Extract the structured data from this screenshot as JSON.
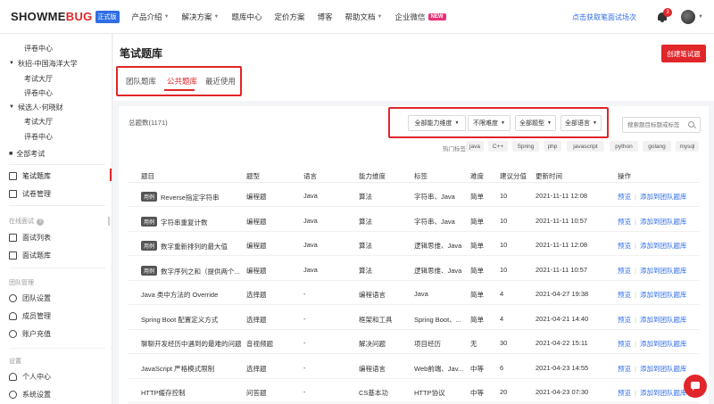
{
  "brand": {
    "logo_main": "SHOWME",
    "logo_accent": "BUG",
    "edition": "正式版"
  },
  "nav": {
    "items": [
      {
        "label": "产品介绍",
        "caret": true
      },
      {
        "label": "解决方案",
        "caret": true
      },
      {
        "label": "题库中心",
        "caret": false
      },
      {
        "label": "定价方案",
        "caret": false
      },
      {
        "label": "博客",
        "caret": false
      },
      {
        "label": "帮助文档",
        "caret": true
      },
      {
        "label": "企业微信",
        "caret": false
      }
    ],
    "new_badge": "NEW",
    "apply_link": "点击获取笔面试场次",
    "notification_count": "3"
  },
  "sidebar": {
    "items": [
      "评卷中心",
      "秋招-中国海洋大学",
      "考试大厅",
      "评卷中心",
      "候选人-何晓财",
      "考试大厅",
      "评卷中心",
      "全部考试",
      "笔试题库",
      "试卷管理",
      "面试列表",
      "面试题库",
      "团队设置",
      "成员管理",
      "账户充值",
      "个人中心",
      "系统设置"
    ],
    "sections": [
      "在线面试",
      "团队管理",
      "设置"
    ],
    "active": "笔试题库"
  },
  "header": {
    "title": "笔试题库",
    "create_button": "创建笔试题",
    "tabs": [
      "团队题库",
      "公共题库",
      "最近使用"
    ],
    "active_tab": "公共题库"
  },
  "filters": {
    "total": "总题数(1171)",
    "ability": "全部能力维度",
    "difficulty": "不限难度",
    "type": "全部题型",
    "language": "全部语言",
    "search_placeholder": "搜索题目标题或标签",
    "hot_label": "热门标签：",
    "hot_tags": [
      "java",
      "C++",
      "Spring",
      "php",
      "javascript",
      "python",
      "golang",
      "mysql"
    ]
  },
  "table": {
    "headers": [
      "题目",
      "题型",
      "语言",
      "能力维度",
      "标签",
      "难度",
      "建议分值",
      "更新时间",
      "操作"
    ],
    "badge": "用例",
    "op_preview": "预览",
    "op_add": "添加到团队题库",
    "op_sep": "|",
    "rows": [
      {
        "badge": true,
        "title": "Reverse指定字符串",
        "type": "编程题",
        "lang": "Java",
        "ability": "算法",
        "tags": "字符串、Java",
        "difficulty": "简单",
        "score": "10",
        "updated": "2021-11-11 12:08"
      },
      {
        "badge": true,
        "title": "字符串重复计数",
        "type": "编程题",
        "lang": "Java",
        "ability": "算法",
        "tags": "字符串、Java",
        "difficulty": "简单",
        "score": "10",
        "updated": "2021-11-11 10:57"
      },
      {
        "badge": true,
        "title": "数字重新排列的最大值",
        "type": "编程题",
        "lang": "Java",
        "ability": "算法",
        "tags": "逻辑思维、Java",
        "difficulty": "简单",
        "score": "10",
        "updated": "2021-11-11 12:08"
      },
      {
        "badge": true,
        "title": "数字序列之和（提供两个...",
        "type": "编程题",
        "lang": "Java",
        "ability": "算法",
        "tags": "逻辑思维、Java",
        "difficulty": "简单",
        "score": "10",
        "updated": "2021-11-11 10:57"
      },
      {
        "badge": false,
        "title": "Java 类中方法的 Override",
        "type": "选择题",
        "lang": "-",
        "ability": "编程语言",
        "tags": "Java",
        "difficulty": "简单",
        "score": "4",
        "updated": "2021-04-27 19:38"
      },
      {
        "badge": false,
        "title": "Spring Boot 配置定义方式",
        "type": "选择题",
        "lang": "-",
        "ability": "框架和工具",
        "tags": "Spring Boot、...",
        "difficulty": "简单",
        "score": "4",
        "updated": "2021-04-21 14:40"
      },
      {
        "badge": false,
        "title": "聊聊开发经历中遇到的最难的问题",
        "type": "音视频题",
        "lang": "-",
        "ability": "解决问题",
        "tags": "项目经历",
        "difficulty": "无",
        "score": "30",
        "updated": "2021-04-22 15:11"
      },
      {
        "badge": false,
        "title": "JavaScript 严格模式限制",
        "type": "选择题",
        "lang": "-",
        "ability": "编程语言",
        "tags": "Web前端、Jav...",
        "difficulty": "中等",
        "score": "6",
        "updated": "2021-04-23 14:55"
      },
      {
        "badge": false,
        "title": "HTTP缓存控制",
        "type": "问答题",
        "lang": "-",
        "ability": "CS基本功",
        "tags": "HTTP协议",
        "difficulty": "中等",
        "score": "20",
        "updated": "2021-04-23 07:30"
      }
    ]
  }
}
